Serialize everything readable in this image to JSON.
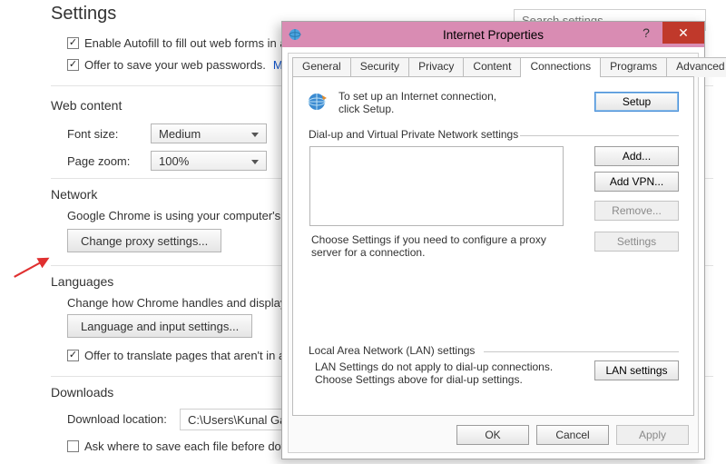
{
  "settings": {
    "title": "Settings",
    "search_placeholder": "Search settings",
    "autofill_label": "Enable Autofill to fill out web forms in a single click.",
    "passwords_label": "Offer to save your web passwords.",
    "manage_link": "Manage passwords",
    "webcontent_heading": "Web content",
    "fontsize_label": "Font size:",
    "fontsize_value": "Medium",
    "pagezoom_label": "Page zoom:",
    "pagezoom_value": "100%",
    "network_heading": "Network",
    "network_desc": "Google Chrome is using your computer's system proxy settings to connect to the network.",
    "proxy_btn": "Change proxy settings...",
    "languages_heading": "Languages",
    "languages_desc": "Change how Chrome handles and displays languages.",
    "language_btn": "Language and input settings...",
    "translate_label": "Offer to translate pages that aren't in a language you read.",
    "downloads_heading": "Downloads",
    "download_loc_label": "Download location:",
    "download_loc_value": "C:\\Users\\Kunal Gaba\\Downloads",
    "ask_where_label": "Ask where to save each file before downloading"
  },
  "ip": {
    "title": "Internet Properties",
    "tabs": [
      "General",
      "Security",
      "Privacy",
      "Content",
      "Connections",
      "Programs",
      "Advanced"
    ],
    "active_tab_index": 4,
    "setup_text": "To set up an Internet connection, click Setup.",
    "setup_btn": "Setup",
    "dialup_heading": "Dial-up and Virtual Private Network settings",
    "add_btn": "Add...",
    "addvpn_btn": "Add VPN...",
    "remove_btn": "Remove...",
    "settings_btn": "Settings",
    "choose_text": "Choose Settings if you need to configure a proxy server for a connection.",
    "lan_heading": "Local Area Network (LAN) settings",
    "lan_text": "LAN Settings do not apply to dial-up connections. Choose Settings above for dial-up settings.",
    "lan_btn": "LAN settings",
    "ok": "OK",
    "cancel": "Cancel",
    "apply": "Apply"
  }
}
